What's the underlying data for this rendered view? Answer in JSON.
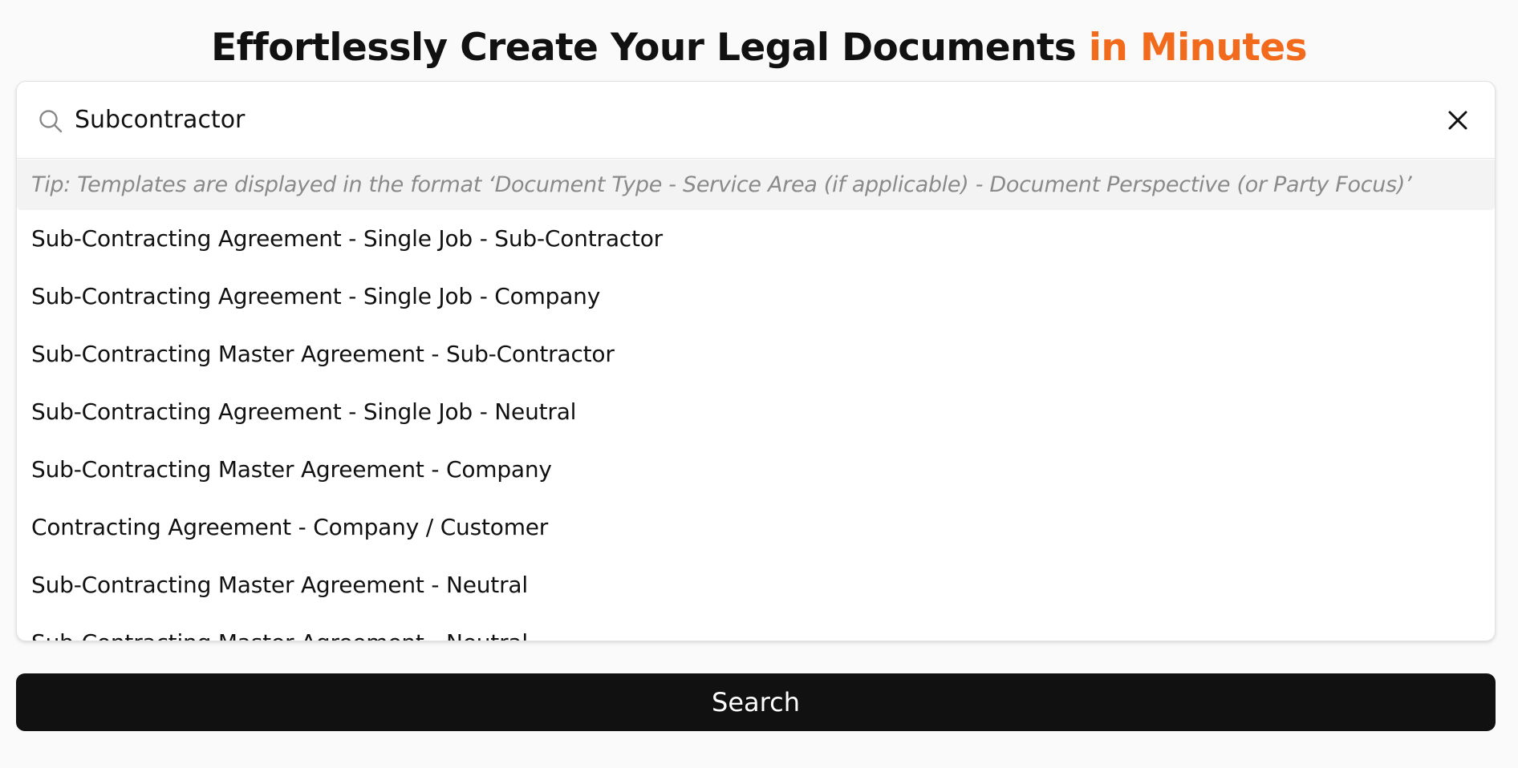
{
  "header": {
    "headline_main": "Effortlessly Create Your Legal Documents ",
    "headline_accent": "in Minutes"
  },
  "colors": {
    "accent": "#f26a1b",
    "button_bg": "#111111",
    "tip_bg": "#f3f3f3",
    "page_bg": "#fafafa"
  },
  "search": {
    "value": "Subcontractor",
    "icon": "search-icon",
    "clear_icon": "close-icon"
  },
  "tip": {
    "text": "Tip: Templates are displayed in the format ‘Document Type - Service Area (if applicable) - Document Perspective (or Party Focus)’"
  },
  "results": [
    "Sub-Contracting Agreement - Single Job - Sub-Contractor",
    "Sub-Contracting Agreement - Single Job - Company",
    "Sub-Contracting Master Agreement - Sub-Contractor",
    "Sub-Contracting Agreement - Single Job - Neutral",
    "Sub-Contracting Master Agreement - Company",
    "Contracting Agreement - Company / Customer",
    "Sub-Contracting Master Agreement - Neutral",
    "Sub-Contracting Master Agreement - Neutral"
  ],
  "search_button": {
    "label": "Search"
  }
}
